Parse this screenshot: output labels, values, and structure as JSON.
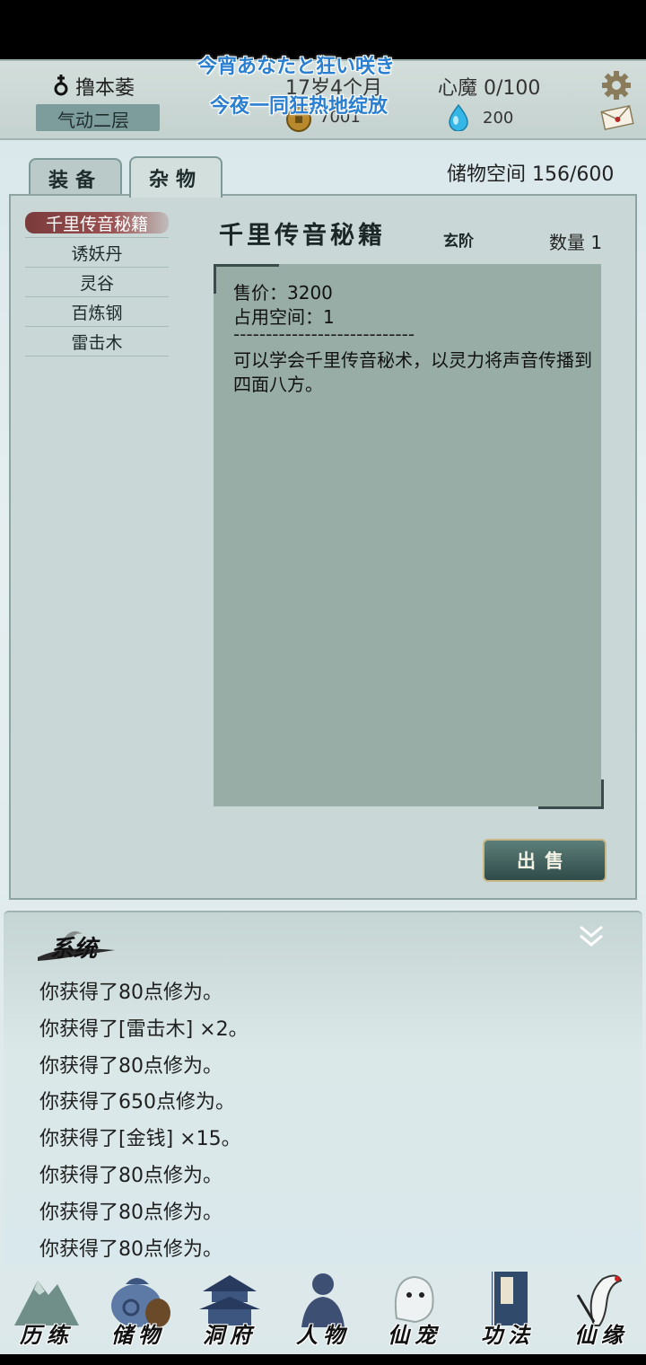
{
  "overlay_lyrics": {
    "line1": "今宵あなたと狂い咲き",
    "line2": "今夜一同狂热地绽放"
  },
  "player": {
    "name": "撸本萎",
    "realm": "气动二层",
    "age": "17岁4个月",
    "demon": "心魔  0/100",
    "coins": "7001",
    "stones": "200"
  },
  "tabs": [
    {
      "label": "装备",
      "active": false
    },
    {
      "label": "杂物",
      "active": true
    }
  ],
  "storage": "储物空间 156/600",
  "items": [
    "千里传音秘籍",
    "诱妖丹",
    "灵谷",
    "百炼钢",
    "雷击木"
  ],
  "selected_item": {
    "title": "千里传音秘籍",
    "grade": "玄阶",
    "quantity": "数量 1",
    "price": "售价：3200",
    "space": "占用空间：1",
    "separator": "----------------------------",
    "description": "可以学会千里传音秘术，以灵力将声音传播到四面八方。"
  },
  "sell_label": "出售",
  "log": {
    "title": "系统",
    "lines": [
      "你获得了80点修为。",
      "你获得了[雷击木] ×2。",
      "你获得了80点修为。",
      "你获得了650点修为。",
      "你获得了[金钱] ×15。",
      "你获得了80点修为。",
      "你获得了80点修为。",
      "你获得了80点修为。"
    ]
  },
  "nav": [
    {
      "label": "历练",
      "icon": "mountain-icon"
    },
    {
      "label": "储物",
      "icon": "bag-icon"
    },
    {
      "label": "洞府",
      "icon": "pagoda-icon"
    },
    {
      "label": "人物",
      "icon": "person-icon"
    },
    {
      "label": "仙宠",
      "icon": "ghost-pet-icon"
    },
    {
      "label": "功法",
      "icon": "book-icon"
    },
    {
      "label": "仙缘",
      "icon": "crane-icon"
    }
  ],
  "colors": {
    "panel": "#c9d8d6",
    "selected_item": "#8a4444",
    "accent": "#2f4b49"
  }
}
